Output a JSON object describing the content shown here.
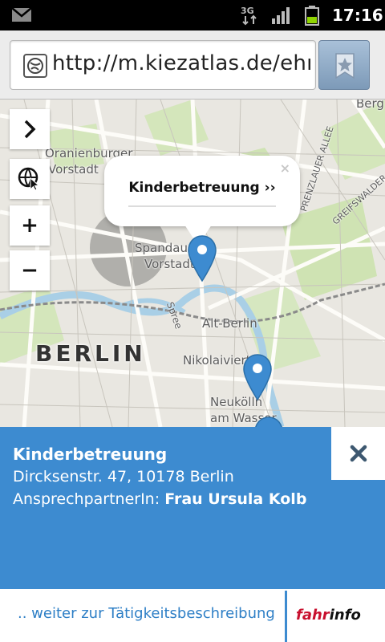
{
  "status_bar": {
    "network": "3G",
    "time": "17:16",
    "icons": [
      "gmail-icon",
      "3g-data-icon",
      "signal-icon",
      "battery-icon"
    ]
  },
  "browser": {
    "url": "http://m.kiezatlas.de/ehr...",
    "favicon": "globe-icon",
    "bookmark_icon": "star-icon"
  },
  "map": {
    "controls": [
      {
        "name": "expand",
        "icon": "chevron-right-icon"
      },
      {
        "name": "locate",
        "icon": "globe-cursor-icon"
      },
      {
        "name": "zoom-in",
        "label": "+"
      },
      {
        "name": "zoom-out",
        "label": "−"
      }
    ],
    "labels": {
      "berg": "Berg",
      "oranienburger": "Oranienburger",
      "vorstadt1": "Vorstadt",
      "spandauer": "Spandauer",
      "vorstadt2": "Vorstadt",
      "altberlin": "Alt-Berlin",
      "nikolai": "Nikolaiviertel",
      "neukolln": "Neukölln",
      "am_wasser": "am Wasser",
      "city": "BERLIN",
      "sprea": "Spree",
      "prenzlauer": "PRENZLAUER ALLEE",
      "greifswalder": "GREIFSWALDER STR"
    },
    "popup": {
      "title": "Kinderbetreuung ››",
      "close": "×"
    },
    "marker_color": "#3d8bd0"
  },
  "info_panel": {
    "title": "Kinderbetreuung",
    "address": "Dircksenstr. 47, 10178 Berlin",
    "contact_label": "AnsprechpartnerIn:",
    "contact_name": "Frau Ursula Kolb",
    "close_icon": "close-icon",
    "background": "#3d8bd0"
  },
  "footer": {
    "more_link": ".. weiter zur Tätigkeitsbeschreibung",
    "logo_red": "fahr",
    "logo_black": "info"
  }
}
